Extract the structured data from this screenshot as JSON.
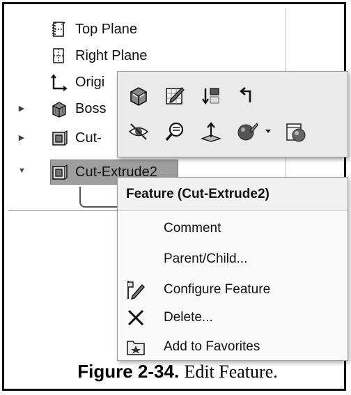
{
  "tree": {
    "items": [
      {
        "label": "Top Plane",
        "icon": "plane-icon"
      },
      {
        "label": "Right Plane",
        "icon": "plane-icon"
      },
      {
        "label": "Origi",
        "icon": "origin-icon"
      },
      {
        "label": "Boss",
        "icon": "boss-extrude-icon"
      },
      {
        "label": "Cut-",
        "icon": "cut-extrude-icon"
      },
      {
        "label": "Cut-Extrude2",
        "icon": "cut-extrude-icon"
      }
    ],
    "sketch_icon": "sketch-icon"
  },
  "toolbar": {
    "row1": [
      "edit-feature-icon",
      "edit-sketch-icon",
      "rollback-icon",
      "parent-child-icon"
    ],
    "row2": [
      "hide-icon",
      "zoom-to-selection-icon",
      "normal-to-icon",
      "appearance-icon",
      "dropdown-arrow-icon",
      "appearance-panel-icon"
    ]
  },
  "menu": {
    "header": "Feature (Cut-Extrude2)",
    "items": [
      {
        "label": "Comment",
        "icon": ""
      },
      {
        "label": "Parent/Child...",
        "icon": ""
      },
      {
        "label": "Configure Feature",
        "icon": "configure-feature-icon"
      },
      {
        "label": "Delete...",
        "icon": "delete-icon"
      },
      {
        "label": "Add to Favorites",
        "icon": "favorites-icon"
      }
    ]
  },
  "caption": {
    "figure": "Figure 2-34.",
    "title": "Edit Feature."
  }
}
